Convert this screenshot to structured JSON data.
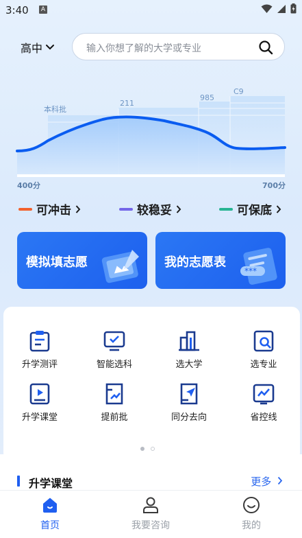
{
  "status": {
    "time": "3:40",
    "notif_badge": "A"
  },
  "header": {
    "grade": "高中",
    "search_placeholder": "输入你想了解的大学或专业"
  },
  "chart_data": {
    "type": "area",
    "title": "",
    "x_range_labels": {
      "min": "400分",
      "max": "700分"
    },
    "tiers": [
      "本科批",
      "211",
      "985",
      "C9"
    ],
    "series": [
      {
        "name": "",
        "description": "score curve",
        "color": "#0a5cf0"
      }
    ]
  },
  "legend": [
    {
      "label": "可冲击",
      "color": "#f2612d"
    },
    {
      "label": "较稳妥",
      "color": "#7466e8"
    },
    {
      "label": "可保底",
      "color": "#28b493"
    }
  ],
  "cards": [
    {
      "title": "模拟填志愿"
    },
    {
      "title": "我的志愿表"
    }
  ],
  "grid": [
    {
      "label": "升学测评",
      "icon": "clipboard-icon"
    },
    {
      "label": "智能选科",
      "icon": "monitor-check-icon"
    },
    {
      "label": "选大学",
      "icon": "building-icon"
    },
    {
      "label": "选专业",
      "icon": "search-doc-icon"
    },
    {
      "label": "升学课堂",
      "icon": "video-book-icon"
    },
    {
      "label": "提前批",
      "icon": "trend-doc-icon"
    },
    {
      "label": "同分去向",
      "icon": "send-doc-icon"
    },
    {
      "label": "省控线",
      "icon": "line-chart-icon"
    }
  ],
  "section": {
    "title": "升学课堂",
    "more": "更多"
  },
  "tabs": [
    {
      "label": "首页",
      "active": true
    },
    {
      "label": "我要咨询",
      "active": false
    },
    {
      "label": "我的",
      "active": false
    }
  ],
  "colors": {
    "accent": "#1f5ff0",
    "icon": "#1a3a8f",
    "inactive": "#9aa0a8"
  }
}
